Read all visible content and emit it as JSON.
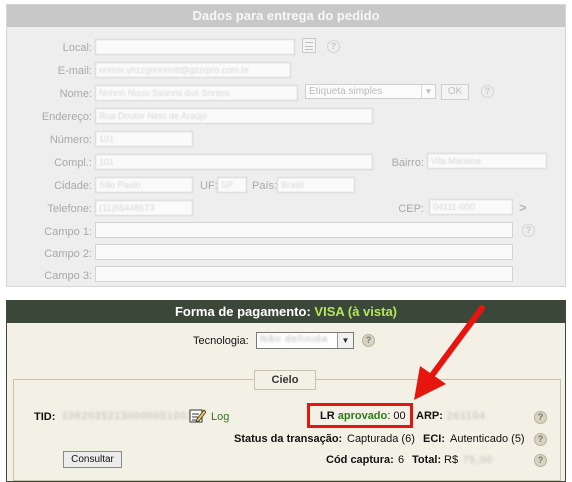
{
  "delivery": {
    "title": "Dados para entrega do pedido",
    "labels": {
      "local": "Local:",
      "email": "E-mail:",
      "nome": "Nome:",
      "endereco": "Endereço:",
      "numero": "Número:",
      "compl": "Compl.:",
      "bairro": "Bairro:",
      "cidade": "Cidade:",
      "uf": "UF:",
      "pais": "País:",
      "telefone": "Telefone:",
      "cep": "CEP:",
      "campo1": "Campo 1:",
      "campo2": "Campo 2:",
      "campo3": "Campo 3:"
    },
    "values": {
      "email": "nnnnn.yhzzgnnnnntt@gzzrpro.com.br",
      "nome": "Nnnnn Nuuu Ssnnns dus Snntos",
      "endereco": "Rua Doutor Neto de Araújo",
      "numero": "101",
      "compl": "101",
      "bairro": "Vila Mariana",
      "cidade": "São Paulo",
      "uf": "SP",
      "pais": "Brasil",
      "telefone": "(11)55448573",
      "cep": "04111-000"
    },
    "label_select": "Etiqueta simples",
    "ok_label": "OK",
    "help_glyph": "?",
    "arrow_glyph": ">"
  },
  "payment": {
    "title_prefix": "Forma de pagamento: ",
    "title_brand": "VISA (à vista)",
    "tecnologia_label": "Tecnologia:",
    "tecnologia_value": "Não definida",
    "cielo_tab": "Cielo",
    "tid_label": "TID:",
    "tid_value": "10620352130000051001",
    "log_label": "Log",
    "lr_label": "LR ",
    "lr_status": "aprovado",
    "lr_code": ": 00",
    "arp_label": "ARP:",
    "arp_value": "261104",
    "status_label": "Status da transação:",
    "status_value": "Capturada (6)",
    "eci_label": "ECI:",
    "eci_value": "Autenticado (5)",
    "cod_label": "Cód captura:",
    "cod_value": "6",
    "total_label": "Total:",
    "total_value": "R$",
    "total_amount": "75,00",
    "consultar_label": "Consultar",
    "help_glyph": "?"
  },
  "colors": {
    "annotation_red": "#e8150f",
    "approved_green": "#2d7a1a",
    "header_dark": "#3b4738"
  }
}
